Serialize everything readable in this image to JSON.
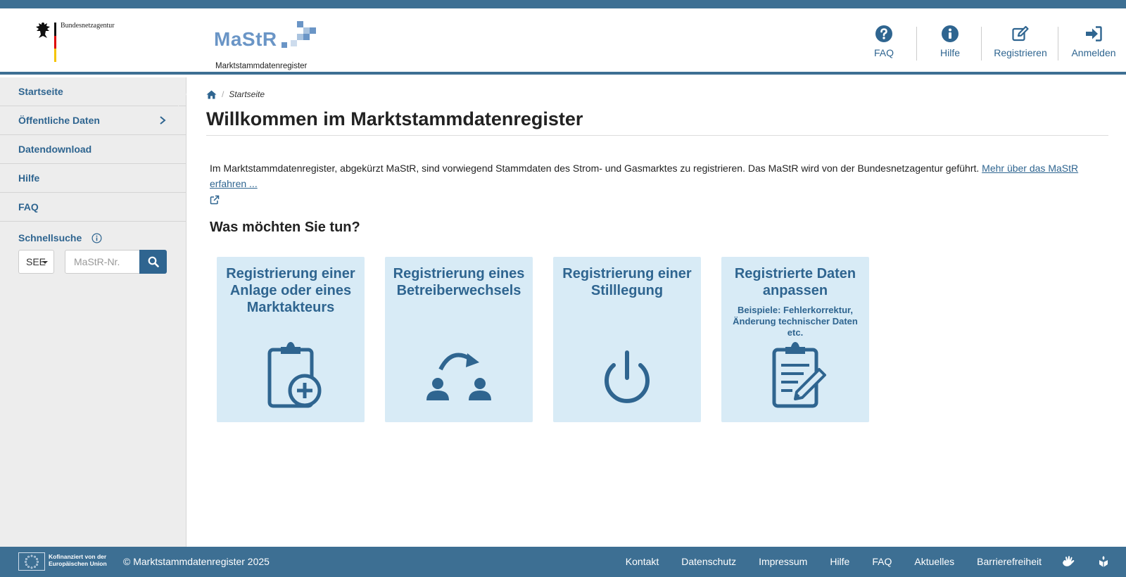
{
  "header": {
    "agency": "Bundesnetzagentur",
    "logo_title": "MaStR",
    "logo_subtitle": "Marktstammdatenregister",
    "nav": [
      {
        "label": "FAQ",
        "icon": "question-circle-icon"
      },
      {
        "label": "Hilfe",
        "icon": "info-circle-icon"
      },
      {
        "label": "Registrieren",
        "icon": "edit-icon"
      },
      {
        "label": "Anmelden",
        "icon": "sign-in-icon"
      }
    ]
  },
  "sidebar": {
    "items": [
      {
        "label": "Startseite"
      },
      {
        "label": "Öffentliche Daten"
      },
      {
        "label": "Datendownload"
      },
      {
        "label": "Hilfe"
      },
      {
        "label": "FAQ"
      }
    ],
    "quicksearch": {
      "label": "Schnellsuche",
      "select_value": "SEE",
      "placeholder": "MaStR-Nr."
    }
  },
  "main": {
    "breadcrumb": "Startseite",
    "title": "Willkommen im Marktstammdatenregister",
    "intro": "Im Marktstammdatenregister, abgekürzt MaStR, sind vorwiegend Stammdaten des Strom- und Gasmarktes zu registrieren. Das MaStR wird von der Bundesnetzagentur geführt.",
    "intro_link": "Mehr über das MaStR erfahren ...",
    "section_title": "Was möchten Sie tun?",
    "tiles": [
      {
        "title": "Registrierung einer Anlage oder eines Marktakteurs",
        "subtitle": "",
        "icon": "clipboard-plus-icon"
      },
      {
        "title": "Registrierung eines Betreiberwechsels",
        "subtitle": "",
        "icon": "users-switch-icon"
      },
      {
        "title": "Registrierung einer Stilllegung",
        "subtitle": "",
        "icon": "power-icon"
      },
      {
        "title": "Registrierte Daten anpassen",
        "subtitle": "Beispiele: Fehlerkorrektur, Änderung technischer Daten etc.",
        "icon": "clipboard-edit-icon"
      }
    ]
  },
  "footer": {
    "eu_line1": "Kofinanziert von der",
    "eu_line2": "Europäischen Union",
    "copyright": "© Marktstammdatenregister 2025",
    "links": [
      "Kontakt",
      "Datenschutz",
      "Impressum",
      "Hilfe",
      "FAQ",
      "Aktuelles",
      "Barrierefreiheit"
    ]
  },
  "colors": {
    "primary": "#2f6590",
    "band": "#3d6f93",
    "tile_bg": "#d8ebf6",
    "sidebar_bg": "#ededed"
  }
}
